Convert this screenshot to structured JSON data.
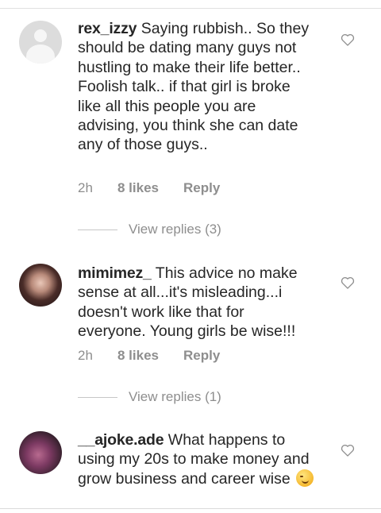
{
  "comments": [
    {
      "username": "rex_izzy",
      "text": "Saying rubbish.. So they should be dating many guys not hustling to make their life better.. Foolish talk.. if that girl is broke like all this people you are advising, you think she can date any of those guys..",
      "time": "2h",
      "likes": "8 likes",
      "reply_label": "Reply",
      "view_replies": "View replies (3)",
      "avatar_icon": "default-avatar-icon",
      "like_icon": "heart-outline-icon"
    },
    {
      "username": "mimimez_",
      "text": "This advice no make sense at all...it's misleading...i doesn't work like that for everyone. Young girls be wise!!!",
      "time": "2h",
      "likes": "8 likes",
      "reply_label": "Reply",
      "view_replies": "View replies (1)",
      "avatar_icon": "user-photo",
      "like_icon": "heart-outline-icon"
    },
    {
      "username": "__ajoke.ade",
      "text": "What happens to using my 20s to make money and grow business and career wise",
      "emoji": "smirking-face-emoji",
      "avatar_icon": "user-photo",
      "like_icon": "heart-outline-icon"
    }
  ],
  "colors": {
    "text": "#262626",
    "meta": "#8e8e8e",
    "divider": "#dbdbdb"
  }
}
